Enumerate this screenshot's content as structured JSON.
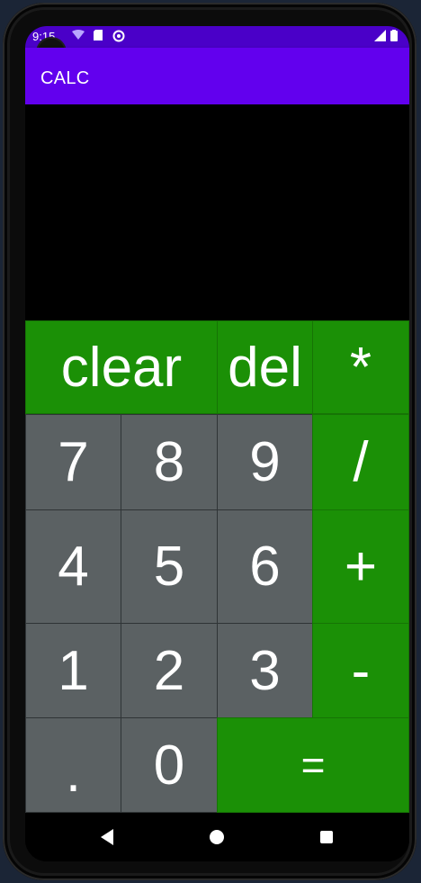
{
  "status_bar": {
    "time": "9:15"
  },
  "app_bar": {
    "title": "CALC"
  },
  "display": {
    "value": ""
  },
  "keypad": {
    "clear": "clear",
    "del": "del",
    "multiply": "*",
    "seven": "7",
    "eight": "8",
    "nine": "9",
    "divide": "/",
    "four": "4",
    "five": "5",
    "six": "6",
    "plus": "+",
    "one": "1",
    "two": "2",
    "three": "3",
    "minus": "-",
    "dot": ".",
    "zero": "0",
    "equals": "="
  },
  "colors": {
    "status_bar": "#4a00c8",
    "app_bar": "#6200ee",
    "operator_key": "#1b9006",
    "number_key": "#5b6163"
  },
  "icons": [
    "wifi-icon",
    "sd-card-icon",
    "sync-icon",
    "signal-icon",
    "battery-icon",
    "back-icon",
    "home-icon",
    "recents-icon"
  ]
}
